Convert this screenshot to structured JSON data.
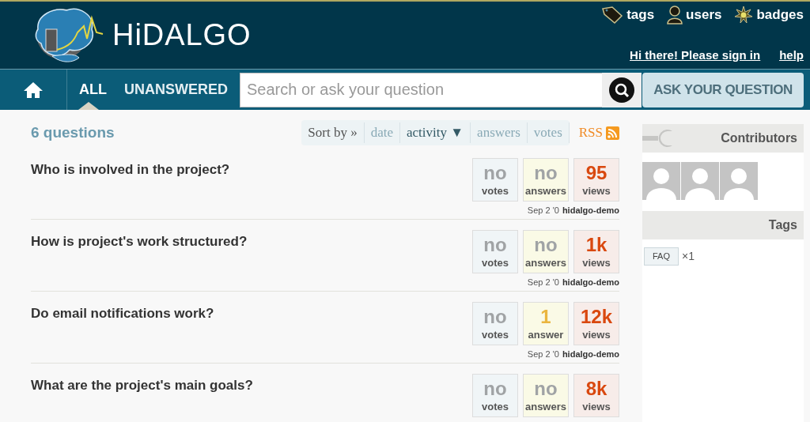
{
  "header": {
    "logo_text": "HiDALGO",
    "links": [
      {
        "kind": "tags",
        "label": "tags"
      },
      {
        "kind": "users",
        "label": "users"
      },
      {
        "kind": "badges",
        "label": "badges"
      }
    ],
    "sign_in": "Hi there! Please sign in",
    "help": "help"
  },
  "nav": {
    "tabs": [
      {
        "label": "ALL",
        "selected": true
      },
      {
        "label": "UNANSWERED",
        "selected": false
      }
    ],
    "search": {
      "placeholder": "Search or ask your question"
    },
    "ask_button": "ASK YOUR QUESTION"
  },
  "count": "6 questions",
  "sort": {
    "label": "Sort by »",
    "options": [
      {
        "label": "date",
        "selected": false
      },
      {
        "label": "activity ▼",
        "selected": true
      },
      {
        "label": "answers",
        "selected": false
      },
      {
        "label": "votes",
        "selected": false
      }
    ],
    "rss": "RSS"
  },
  "questions": [
    {
      "title": "Who is involved in the project?",
      "stats": [
        {
          "kind": "votes",
          "value": "no",
          "label": "votes",
          "has_value": false
        },
        {
          "kind": "answers",
          "value": "no",
          "label": "answers",
          "has_value": false
        },
        {
          "kind": "views",
          "value": "95",
          "label": "views",
          "has_value": true
        }
      ],
      "date": "Sep 2 '0",
      "author": "hidalgo-demo"
    },
    {
      "title": "How is project's work structured?",
      "stats": [
        {
          "kind": "votes",
          "value": "no",
          "label": "votes",
          "has_value": false
        },
        {
          "kind": "answers",
          "value": "no",
          "label": "answers",
          "has_value": false
        },
        {
          "kind": "views",
          "value": "1k",
          "label": "views",
          "has_value": true
        }
      ],
      "date": "Sep 2 '0",
      "author": "hidalgo-demo"
    },
    {
      "title": "Do email notifications work?",
      "stats": [
        {
          "kind": "votes",
          "value": "no",
          "label": "votes",
          "has_value": false
        },
        {
          "kind": "answers",
          "value": "1",
          "label": "answer",
          "has_value": true
        },
        {
          "kind": "views",
          "value": "12k",
          "label": "views",
          "has_value": true
        }
      ],
      "date": "Sep 2 '0",
      "author": "hidalgo-demo"
    },
    {
      "title": "What are the project's main goals?",
      "stats": [
        {
          "kind": "votes",
          "value": "no",
          "label": "votes",
          "has_value": false
        },
        {
          "kind": "answers",
          "value": "no",
          "label": "answers",
          "has_value": false
        },
        {
          "kind": "views",
          "value": "8k",
          "label": "views",
          "has_value": true
        }
      ]
    }
  ],
  "sidebar": {
    "contributors": {
      "title": "Contributors",
      "avatars": [
        {
          "kind": "placeholder"
        },
        {
          "kind": "placeholder"
        },
        {
          "kind": "placeholder"
        }
      ]
    },
    "tags": {
      "title": "Tags",
      "items": [
        {
          "name": "FAQ",
          "count": "×1"
        }
      ]
    }
  }
}
